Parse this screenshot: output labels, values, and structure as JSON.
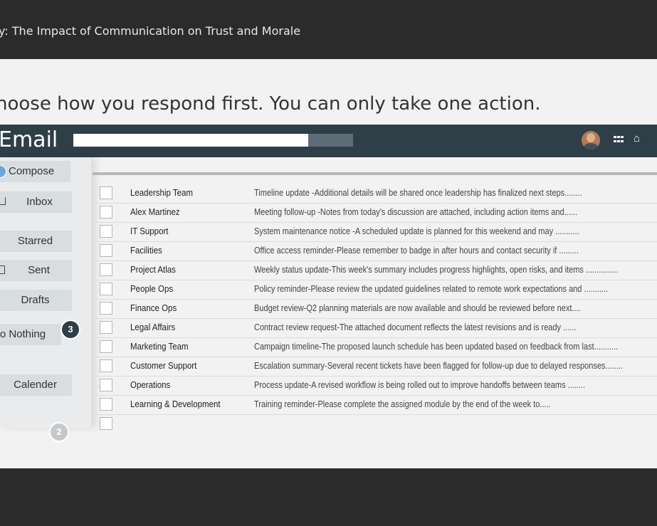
{
  "course": {
    "title": "y: The Impact of Communication on Trust and Morale"
  },
  "instruction": "hoose how you respond first. You can only take one action.",
  "email": {
    "app_title": "Email",
    "nav": {
      "compose": "Compose",
      "inbox": "Inbox",
      "starred": "Starred",
      "sent": "Sent",
      "drafts": "Drafts",
      "do_nothing": "Do Nothing",
      "calender": "Calender"
    },
    "badges": {
      "do_nothing": "3",
      "calender": "2"
    },
    "icons": {
      "compose": "compose-plus-icon",
      "inbox": "inbox-tray-icon",
      "sent": "send-icon",
      "apps": "grid-icon",
      "home": "home-icon",
      "avatar": "user-avatar"
    },
    "messages": [
      {
        "sender": "Leadership Team",
        "preview": "Timeline update -Additional details will be shared once leadership has finalized next steps........"
      },
      {
        "sender": "Alex Martinez",
        "preview": "Meeting follow-up -Notes from today's discussion are attached, including action items and......"
      },
      {
        "sender": "IT Support",
        "preview": "System maintenance notice -A scheduled update is planned for this weekend and may ..........."
      },
      {
        "sender": "Facilities",
        "preview": "Office access reminder-Please remember to badge in after hours and contact security if ........."
      },
      {
        "sender": "Project Atlas",
        "preview": "Weekly status update-This week's summary includes progress highlights, open risks, and items ..............."
      },
      {
        "sender": "People Ops",
        "preview": "Policy reminder-Please review the updated guidelines related to remote work expectations and ..........."
      },
      {
        "sender": "Finance Ops",
        "preview": "Budget review-Q2 planning materials are now available and should be reviewed before next...."
      },
      {
        "sender": "Legal Affairs",
        "preview": "Contract review request-The attached document reflects the latest revisions and is ready ......"
      },
      {
        "sender": "Marketing Team",
        "preview": "Campaign timeline-The proposed launch schedule has been updated based on feedback from last..........."
      },
      {
        "sender": "Customer Support",
        "preview": "Escalation summary-Several recent tickets have been flagged for follow-up due to delayed responses........"
      },
      {
        "sender": "Operations",
        "preview": "Process update-A revised workflow is being rolled out to improve handoffs between teams ........"
      },
      {
        "sender": "Learning & Development",
        "preview": "Training reminder-Please complete the assigned module by the end of the week to....."
      }
    ]
  },
  "colors": {
    "header": "#2f3f48",
    "page_bar": "#2b2b2b",
    "badge_dark": "#2e3e48",
    "badge_light": "#c4c8cb"
  }
}
